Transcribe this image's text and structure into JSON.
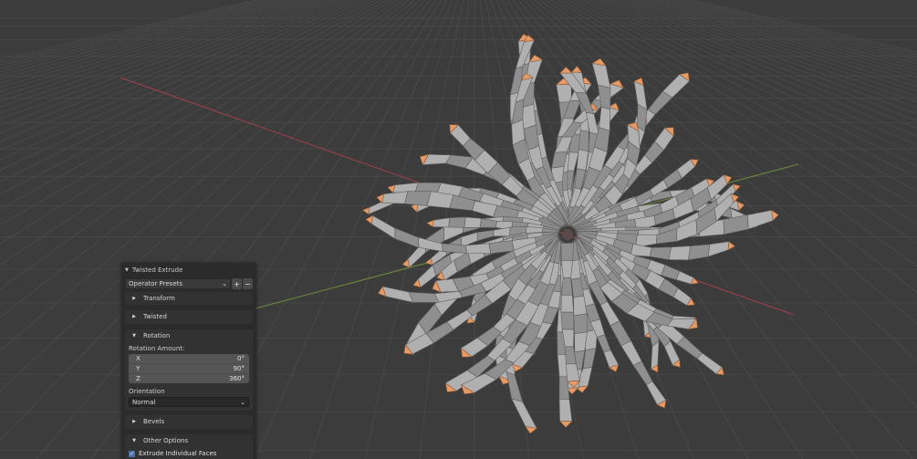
{
  "panel": {
    "title": "Twisted Extrude",
    "presets_label": "Operator Presets",
    "add_preset": "+",
    "remove_preset": "−",
    "sections": {
      "transform": "Transform",
      "twisted": "Twisted",
      "rotation": "Rotation",
      "bevels": "Bevels",
      "other_options": "Other Options"
    },
    "rotation_amount_label": "Rotation Amount:",
    "rotation": [
      {
        "axis": "X",
        "value": "0°"
      },
      {
        "axis": "Y",
        "value": "90°"
      },
      {
        "axis": "Z",
        "value": "360°"
      }
    ],
    "orientation_label": "Orientation",
    "orientation_value": "Normal",
    "extrude_individual_faces": "Extrude Individual Faces",
    "extrude_individual_faces_checked": true
  },
  "colors": {
    "background": "#3c3c3c",
    "x_axis": "#b3414f",
    "y_axis": "#7a9a3c",
    "mesh_face": "#b0b0b0",
    "mesh_cap": "#e69a66",
    "checkbox": "#4772b3"
  },
  "icons": {
    "collapsed": "triangle-right",
    "expanded": "triangle-down",
    "dropdown": "chevron-down",
    "checkbox": "check"
  }
}
